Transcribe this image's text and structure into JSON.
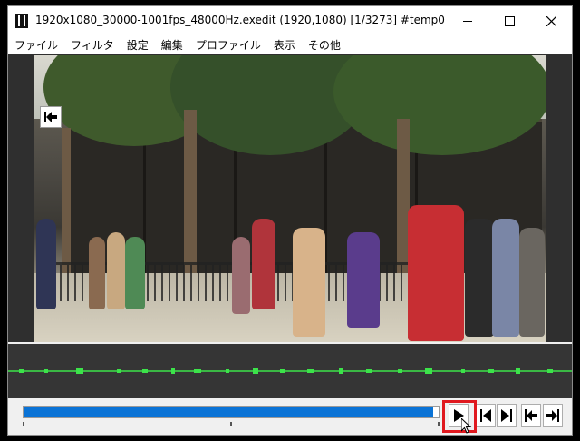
{
  "window": {
    "title": "1920x1080_30000-1001fps_48000Hz.exedit (1920,1080)  [1/3273]  #temp0",
    "app_icon": "film-icon",
    "controls": [
      "minimize-icon",
      "maximize-icon",
      "close-icon"
    ]
  },
  "menu": {
    "items": [
      "ファイル",
      "フィルタ",
      "設定",
      "編集",
      "プロファイル",
      "表示",
      "その他"
    ]
  },
  "preview": {
    "overlay_icon": "skip-to-start-icon"
  },
  "timeline": {
    "seek_progress": 0.99,
    "buttons": [
      {
        "name": "play-button",
        "icon": "play-icon"
      },
      {
        "name": "prev-frame-button",
        "icon": "step-back-icon"
      },
      {
        "name": "next-frame-button",
        "icon": "step-forward-icon"
      },
      {
        "name": "go-start-button",
        "icon": "skip-start-icon"
      },
      {
        "name": "go-end-button",
        "icon": "skip-end-icon"
      }
    ],
    "highlight_color": "#e0191f",
    "seek_color": "#0a73d6",
    "waveform_color": "#3ce34a"
  }
}
